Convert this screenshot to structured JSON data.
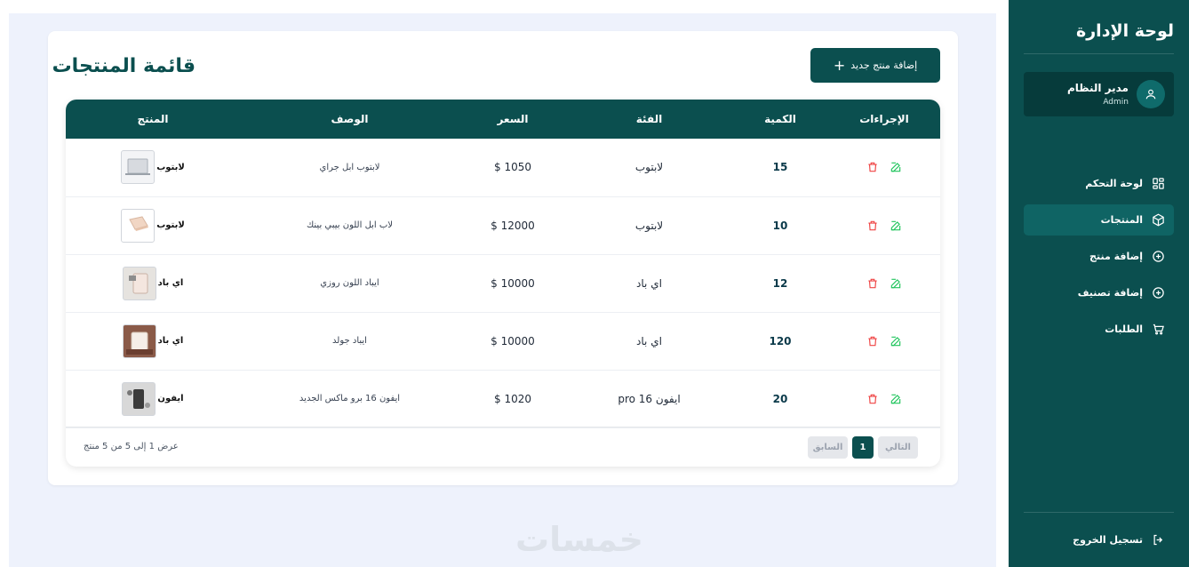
{
  "sidebar": {
    "title": "لوحة الإدارة",
    "user": {
      "name": "مدير النظام",
      "role": "Admin"
    },
    "items": [
      {
        "label": "لوحة التحكم",
        "icon": "grid-icon"
      },
      {
        "label": "المنتجات",
        "icon": "box-icon",
        "active": true
      },
      {
        "label": "إضافة منتج",
        "icon": "plus-circle-icon"
      },
      {
        "label": "إضافة تصنيف",
        "icon": "plus-circle-icon"
      },
      {
        "label": "الطلبات",
        "icon": "cart-icon"
      }
    ],
    "logout": "تسجيل الخروج"
  },
  "main": {
    "title": "قائمة المنتجات",
    "add_button": "إضافة منتج جديد",
    "columns": [
      "الإجراءات",
      "الكمية",
      "الفئة",
      "السعر",
      "الوصف",
      "المنتج"
    ],
    "rows": [
      {
        "qty": "15",
        "category": "لابتوب",
        "price": "1050 $",
        "desc": "لابتوب ابل جراي",
        "name": "لابتوب"
      },
      {
        "qty": "10",
        "category": "لابتوب",
        "price": "12000 $",
        "desc": "لاب ابل اللون بيبي بينك",
        "name": "لابتوب"
      },
      {
        "qty": "12",
        "category": "اي باد",
        "price": "10000 $",
        "desc": "ايباد اللون روزي",
        "name": "اي باد"
      },
      {
        "qty": "120",
        "category": "اي باد",
        "price": "10000 $",
        "desc": "ايباد جولد",
        "name": "اي باد"
      },
      {
        "qty": "20",
        "category": "ايفون 16 pro",
        "price": "1020 $",
        "desc": "ايفون 16 برو ماكس الجديد",
        "name": "ايفون"
      }
    ],
    "pagination": {
      "next": "التالي",
      "current": "1",
      "prev": "السابق"
    },
    "count_text": "عرض 1 إلى 5 من 5 منتج"
  },
  "watermark": "خمسات",
  "colors": {
    "primary": "#0b4f4f",
    "edit": "#22c55e",
    "delete": "#ef4444"
  }
}
